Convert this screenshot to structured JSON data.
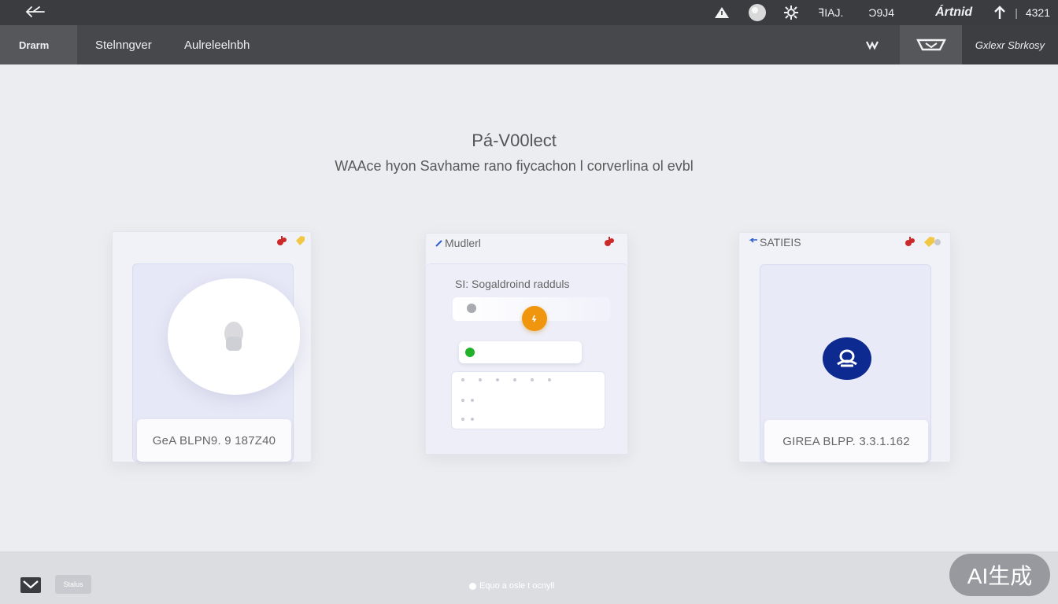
{
  "topbar": {
    "tray": {
      "text1": "ꟻIAJ.",
      "text2": "Ɔ9J4",
      "brand": "Ártnid",
      "divider": "|",
      "time": "4321"
    }
  },
  "nav": {
    "tabs": [
      "Drarm",
      "Stelnngver",
      "Aulreleelnbh"
    ],
    "account": "Gxlexr Sbrkosy"
  },
  "main": {
    "title": "Pá-V00lect",
    "subtitle": "WAAce hyon Savhame rano fiycachon l corverlina ol evbl"
  },
  "cards": [
    {
      "title": "",
      "pill": "GeA BLPN9. 9 187Z40"
    },
    {
      "title": "Mudlerl",
      "section_label": "SI: Sogaldroind radduls"
    },
    {
      "title": "SATIEIS",
      "pill": "GIREA BLPP. 3.3.1.162"
    }
  ],
  "bottombar": {
    "chip": "Stalus",
    "status": "Equo a osle t ocnyll"
  },
  "watermark": "AI生成",
  "colors": {
    "topbar": "#3a3c40",
    "navbar": "#46484c",
    "accent_orange": "#f0960e",
    "accent_green": "#22b22a",
    "accent_blue": "#0c2a8f",
    "badge_red": "#cc2a2a",
    "badge_yellow": "#f2c744"
  }
}
